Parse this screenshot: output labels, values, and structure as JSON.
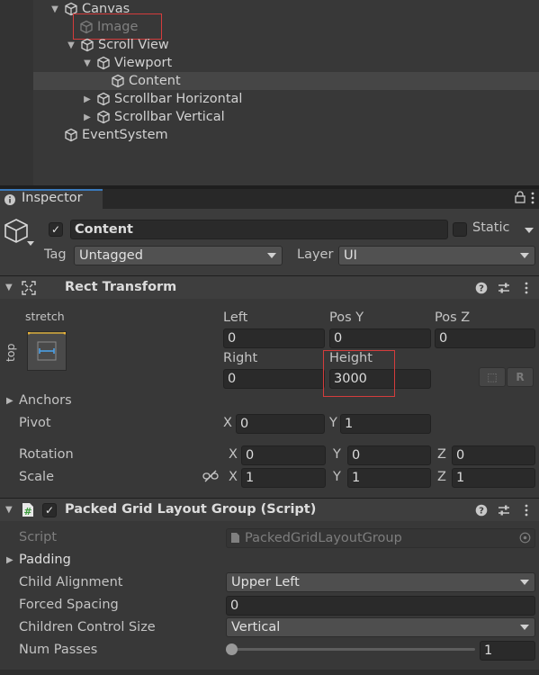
{
  "hierarchy": {
    "items": [
      {
        "label": "Canvas"
      },
      {
        "label": "Image"
      },
      {
        "label": "Scroll View"
      },
      {
        "label": "Viewport"
      },
      {
        "label": "Content"
      },
      {
        "label": "Scrollbar Horizontal"
      },
      {
        "label": "Scrollbar Vertical"
      },
      {
        "label": "EventSystem"
      }
    ]
  },
  "inspector": {
    "tab_label": "Inspector",
    "object_name": "Content",
    "active": true,
    "static_label": "Static",
    "tag_label": "Tag",
    "tag_value": "Untagged",
    "layer_label": "Layer",
    "layer_value": "UI"
  },
  "rect_transform": {
    "title": "Rect Transform",
    "anchor_preset_h": "stretch",
    "anchor_preset_v": "top",
    "labels": {
      "left": "Left",
      "pos_y": "Pos Y",
      "pos_z": "Pos Z",
      "right": "Right",
      "height": "Height"
    },
    "values": {
      "left": "0",
      "pos_y": "0",
      "pos_z": "0",
      "right": "0",
      "height": "3000"
    },
    "blueprint_btn": "⬚",
    "raw_btn": "R",
    "anchors_label": "Anchors",
    "pivot_label": "Pivot",
    "pivot": {
      "x": "0",
      "y": "1"
    },
    "rotation_label": "Rotation",
    "rotation": {
      "x": "0",
      "y": "0",
      "z": "0"
    },
    "scale_label": "Scale",
    "scale": {
      "x": "1",
      "y": "1",
      "z": "1"
    },
    "axis": {
      "x": "X",
      "y": "Y",
      "z": "Z"
    }
  },
  "layout_group": {
    "title": "Packed Grid Layout Group (Script)",
    "enabled": true,
    "script_label": "Script",
    "script_value": "PackedGridLayoutGroup",
    "padding_label": "Padding",
    "child_alignment_label": "Child Alignment",
    "child_alignment_value": "Upper Left",
    "forced_spacing_label": "Forced Spacing",
    "forced_spacing_value": "0",
    "children_control_size_label": "Children Control Size",
    "children_control_size_value": "Vertical",
    "num_passes_label": "Num Passes",
    "num_passes_value": "1"
  },
  "colors": {
    "background": "#383838",
    "selection": "#464646",
    "highlight_box": "#d43c3c",
    "tab_accent": "#3a79bb"
  }
}
